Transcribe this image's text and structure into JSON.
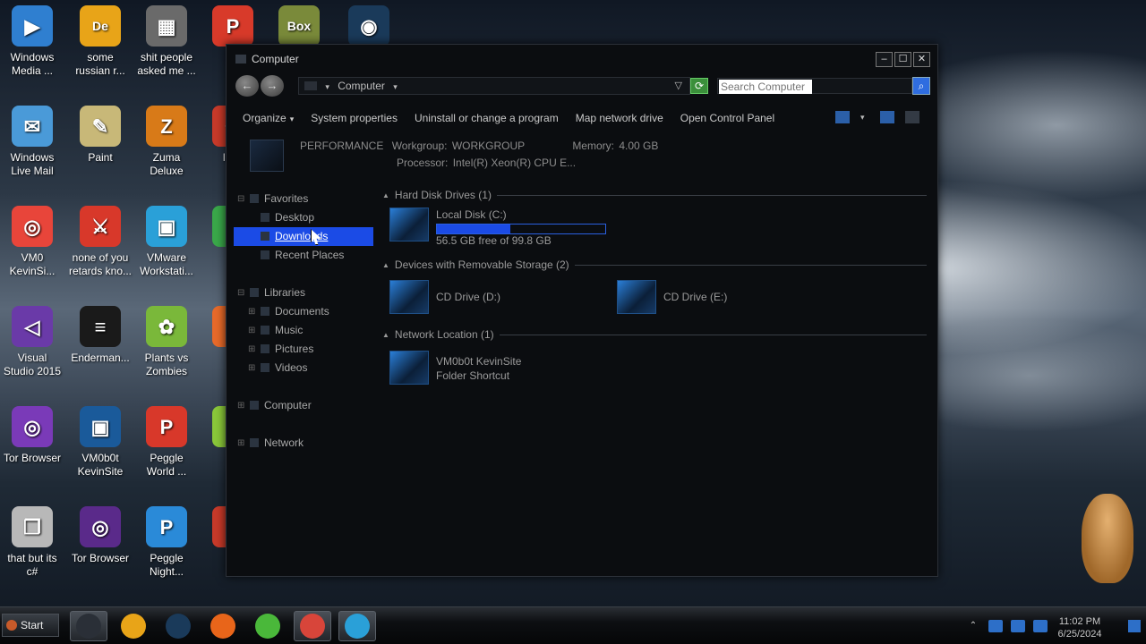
{
  "desktop": {
    "icons": [
      {
        "label": "Windows\nMedia ...",
        "color": "#2f7fd0",
        "glyph": "▶"
      },
      {
        "label": "some\nrussian r...",
        "color": "#e8a418",
        "glyph": "De"
      },
      {
        "label": "shit people\nasked me ...",
        "color": "#6a6a6a",
        "glyph": "▦"
      },
      {
        "label": "P\nD",
        "color": "#d83a2a",
        "glyph": "P"
      },
      {
        "label": "",
        "color": "#7a8a3a",
        "glyph": "Box"
      },
      {
        "label": "",
        "color": "#1a3a5a",
        "glyph": "◉"
      },
      {
        "label": "Windows\nLive Mail",
        "color": "#4a9ad8",
        "glyph": "✉"
      },
      {
        "label": "Paint",
        "color": "#c8b878",
        "glyph": "✎"
      },
      {
        "label": "Zuma\nDeluxe",
        "color": "#d87a18",
        "glyph": "Z"
      },
      {
        "label": "Insa\nD",
        "color": "#c83a2a",
        "glyph": "✦"
      },
      {
        "label": "VM0\nKevinSi...",
        "color": "#e8453a",
        "glyph": "◎"
      },
      {
        "label": "none of you\nretards kno...",
        "color": "#d8382a",
        "glyph": "⚔"
      },
      {
        "label": "VMware\nWorkstati...",
        "color": "#2aa0d8",
        "glyph": "▣"
      },
      {
        "label": "G\nCl",
        "color": "#3aa84a",
        "glyph": "●"
      },
      {
        "label": "Visual\nStudio 2015",
        "color": "#6a3aa8",
        "glyph": "◁"
      },
      {
        "label": "Enderman...",
        "color": "#1a1a1a",
        "glyph": "≡"
      },
      {
        "label": "Plants vs\nZombies",
        "color": "#7ab83a",
        "glyph": "✿"
      },
      {
        "label": "F",
        "color": "#e86a2a",
        "glyph": "●"
      },
      {
        "label": "Tor Browser",
        "color": "#7a3ab8",
        "glyph": "◎"
      },
      {
        "label": "VM0b0t\nKevinSite",
        "color": "#1a5a9a",
        "glyph": "▣"
      },
      {
        "label": "Peggle\nWorld ...",
        "color": "#d8382a",
        "glyph": "P"
      },
      {
        "label": "Co",
        "color": "#8ac83a",
        "glyph": "●"
      },
      {
        "label": "that but its\nc#",
        "color": "#b8b8b8",
        "glyph": "❐"
      },
      {
        "label": "Tor Browser",
        "color": "#5a2a8a",
        "glyph": "◎"
      },
      {
        "label": "Peggle\nNight...",
        "color": "#2a8ad8",
        "glyph": "P"
      },
      {
        "label": "C\nD",
        "color": "#c83a2a",
        "glyph": "●"
      }
    ]
  },
  "window": {
    "title": "Computer",
    "minimize_glyph": "–",
    "maximize_glyph": "☐",
    "close_glyph": "✕",
    "address": {
      "back_glyph": "←",
      "forward_glyph": "→",
      "dropdown_glyph": "▾",
      "location": "Computer",
      "history_glyph": "▽",
      "refresh_glyph": "⟳",
      "search_placeholder": "Search Computer",
      "search_glyph": "⌕"
    },
    "toolbar": {
      "organize": "Organize",
      "system_properties": "System properties",
      "uninstall": "Uninstall or change a program",
      "map_drive": "Map network drive",
      "control_panel": "Open Control Panel",
      "caret": "▾"
    },
    "details": {
      "name": "PERFORMANCE",
      "workgroup_label": "Workgroup:",
      "workgroup_value": "WORKGROUP",
      "memory_label": "Memory:",
      "memory_value": "4.00 GB",
      "processor_label": "Processor:",
      "processor_value": "Intel(R) Xeon(R) CPU E..."
    },
    "nav": {
      "favorites": "Favorites",
      "desktop": "Desktop",
      "downloads": "Downloads",
      "recent": "Recent Places",
      "libraries": "Libraries",
      "documents": "Documents",
      "music": "Music",
      "pictures": "Pictures",
      "videos": "Videos",
      "computer": "Computer",
      "network": "Network",
      "collapse_glyph": "⊟",
      "expand_glyph": "⊞"
    },
    "content": {
      "hdd_group": "Hard Disk Drives (1)",
      "local_disk": "Local Disk (C:)",
      "local_disk_free": "56.5 GB free of 99.8 GB",
      "local_disk_used_fraction": 0.434,
      "removable_group": "Devices with Removable Storage (2)",
      "cd_d": "CD Drive (D:)",
      "cd_e": "CD Drive (E:)",
      "network_group": "Network Location (1)",
      "net_name": "VM0b0t KevinSite",
      "net_type": "Folder Shortcut",
      "group_tri": "▲"
    }
  },
  "taskbar": {
    "start_label": "Start",
    "apps": [
      {
        "name": "explorer",
        "color": "#2a2f37",
        "active": true
      },
      {
        "name": "media-player",
        "color": "#e8a418",
        "active": false
      },
      {
        "name": "globe",
        "color": "#1a3a5a",
        "active": false
      },
      {
        "name": "firefox",
        "color": "#e8651a",
        "active": false
      },
      {
        "name": "green-app",
        "color": "#4ab83a",
        "active": false
      },
      {
        "name": "chrome",
        "color": "#d8453a",
        "active": true
      },
      {
        "name": "vmware",
        "color": "#2aa0d8",
        "active": true
      }
    ],
    "tray_up": "⌃",
    "time": "11:02 PM",
    "date": "6/25/2024"
  }
}
